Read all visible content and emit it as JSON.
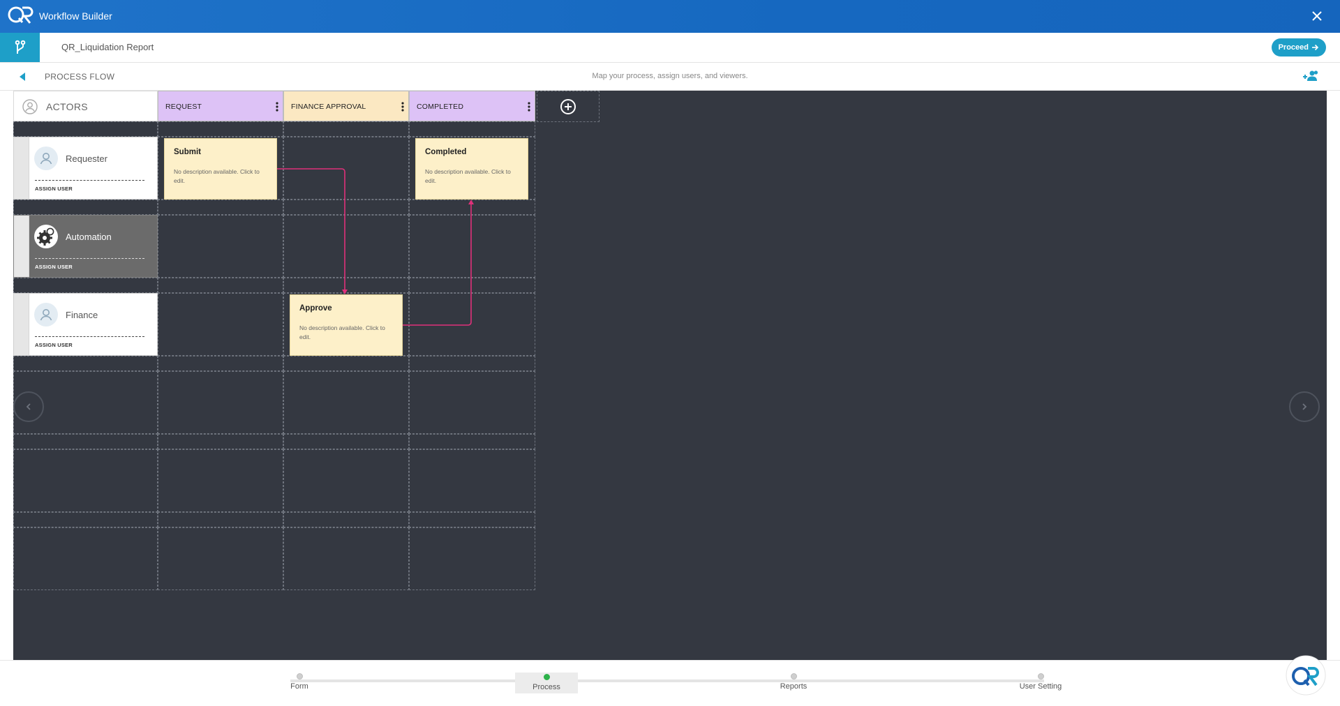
{
  "app": {
    "title": "Workflow Builder"
  },
  "header": {
    "document_title": "QR_Liquidation Report",
    "proceed_label": "Proceed"
  },
  "subheader": {
    "section_label": "PROCESS FLOW",
    "hint": "Map your process, assign users, and viewers."
  },
  "board": {
    "actors_label": "ACTORS",
    "columns": [
      {
        "label": "REQUEST",
        "color": "#ddc2f6"
      },
      {
        "label": "FINANCE APPROVAL",
        "color": "#fbe8c2"
      },
      {
        "label": "COMPLETED",
        "color": "#ddc2f6"
      }
    ],
    "actors": [
      {
        "name": "Requester",
        "assign_label": "ASSIGN USER"
      },
      {
        "name": "Automation",
        "assign_label": "ASSIGN USER"
      },
      {
        "name": "Finance",
        "assign_label": "ASSIGN USER"
      }
    ],
    "tasks": [
      {
        "title": "Submit",
        "description": "No description available. Click to edit."
      },
      {
        "title": "Completed",
        "description": "No description available. Click to edit."
      },
      {
        "title": "Approve",
        "description": "No description available. Click to edit."
      }
    ],
    "connector_color": "#e0307a"
  },
  "footer": {
    "steps": [
      {
        "label": "Form"
      },
      {
        "label": "Process"
      },
      {
        "label": "Reports"
      },
      {
        "label": "User Setting"
      }
    ],
    "active_step": "Process"
  },
  "colors": {
    "title_bar": "#1668c0",
    "accent": "#1e9fc8",
    "canvas": "#343841",
    "task_card": "#fdf0c9",
    "active_step_dot": "#2db24a"
  }
}
